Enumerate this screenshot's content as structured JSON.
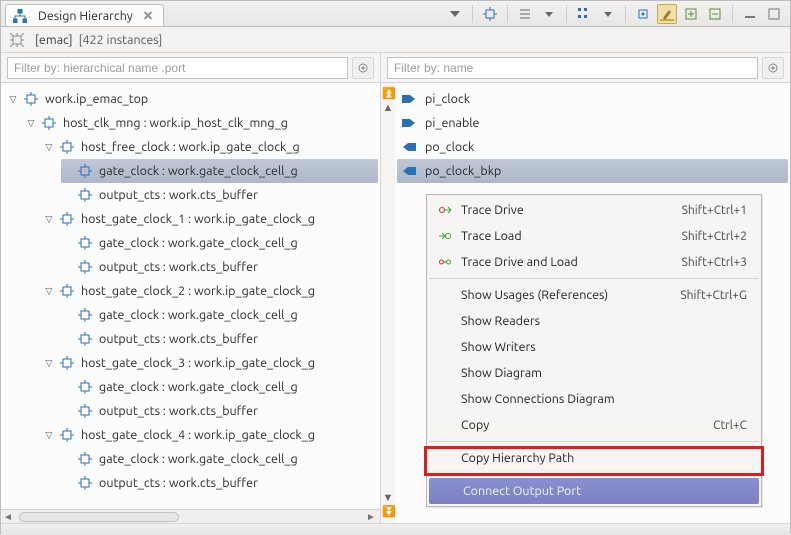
{
  "tab": {
    "title": "Design Hierarchy"
  },
  "crumb": {
    "name": "[emac]",
    "count": "[422 instances]"
  },
  "filters": {
    "left_placeholder": "Filter by: hierarchical name .port",
    "right_placeholder": "Filter by: name"
  },
  "tree": {
    "root": "work.ip_emac_top",
    "n1": "host_clk_mng : work.ip_host_clk_mng_g",
    "n1_1": "host_free_clock : work.ip_gate_clock_g",
    "n1_1_1": "gate_clock : work.gate_clock_cell_g",
    "n1_1_2": "output_cts : work.cts_buffer",
    "n1_2": "host_gate_clock_1 : work.ip_gate_clock_g",
    "n1_2_1": "gate_clock : work.gate_clock_cell_g",
    "n1_2_2": "output_cts : work.cts_buffer",
    "n1_3": "host_gate_clock_2 : work.ip_gate_clock_g",
    "n1_3_1": "gate_clock : work.gate_clock_cell_g",
    "n1_3_2": "output_cts : work.cts_buffer",
    "n1_4": "host_gate_clock_3 : work.ip_gate_clock_g",
    "n1_4_1": "gate_clock : work.gate_clock_cell_g",
    "n1_4_2": "output_cts : work.cts_buffer",
    "n1_5": "host_gate_clock_4 : work.ip_gate_clock_g",
    "n1_5_1": "gate_clock : work.gate_clock_cell_g",
    "n1_5_2": "output_cts : work.cts_buffer"
  },
  "ports": {
    "p0": "pi_clock",
    "p1": "pi_enable",
    "p2": "po_clock",
    "p3": "po_clock_bkp"
  },
  "context_menu": {
    "trace_drive": {
      "label": "Trace Drive",
      "accel": "Shift+Ctrl+1"
    },
    "trace_load": {
      "label": "Trace Load",
      "accel": "Shift+Ctrl+2"
    },
    "trace_both": {
      "label": "Trace Drive and Load",
      "accel": "Shift+Ctrl+3"
    },
    "show_usages": {
      "label": "Show Usages (References)",
      "accel": "Shift+Ctrl+G"
    },
    "show_readers": {
      "label": "Show Readers"
    },
    "show_writers": {
      "label": "Show Writers"
    },
    "show_diagram": {
      "label": "Show Diagram"
    },
    "show_conn_diagram": {
      "label": "Show Connections Diagram"
    },
    "copy": {
      "label": "Copy",
      "accel": "Ctrl+C"
    },
    "copy_path": {
      "label": "Copy Hierarchy Path"
    },
    "connect_output": {
      "label": "Connect Output Port"
    }
  }
}
